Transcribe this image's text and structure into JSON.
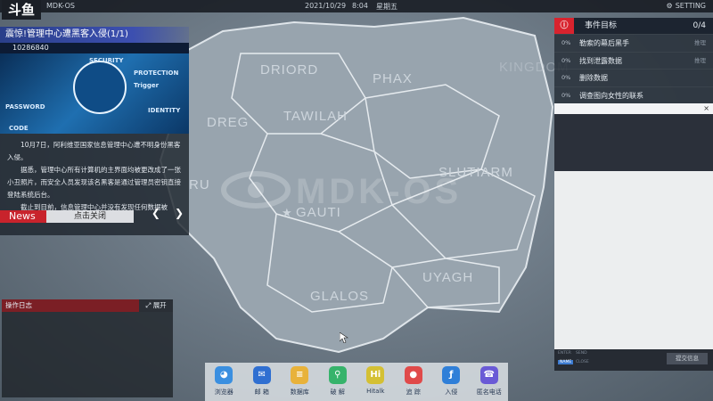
{
  "topbar": {
    "logo": "斗鱼",
    "os_name": "MDK-OS",
    "date": "2021/10/29",
    "time": "8:04",
    "weekday": "星期五",
    "setting": "SETTING"
  },
  "map": {
    "watermark": "MDK-OS",
    "regions": [
      "DRIORD",
      "PHAX",
      "DREG",
      "TAWILAH",
      "SLUTIARM",
      "GAUTI",
      "UYAGH",
      "GLALOS",
      "RU",
      "KINGDOM"
    ]
  },
  "news": {
    "title": "震惊!管理中心遭黑客入侵(1/1)",
    "id": "10286840",
    "banner_keywords": [
      "PASSWORD",
      "PROTECTION",
      "IDENTITY",
      "Trigger",
      "CODE",
      "SECURITY"
    ],
    "paragraphs": [
      "10月7日，阿利维亚国家信息管理中心遭不明身份黑客入侵。",
      "据悉，管理中心所有计算机的主界面均被更改成了一张小丑照片，而安全人员发现该名黑客是通过管理员密钥直接登陆系统后台。",
      "截止到目前，信息管理中心并没有发现任何数据被"
    ],
    "prev": "❮",
    "next": "❯",
    "tab_label": "News",
    "close_label": "点击关闭"
  },
  "log": {
    "title": "操作日志",
    "expand": "展开"
  },
  "objectives": {
    "title": "事件目标",
    "count": "0/4",
    "items": [
      {
        "pct": "0%",
        "text": "勒索的幕后黑手",
        "hint": "推理"
      },
      {
        "pct": "0%",
        "text": "找到泄露数据",
        "hint": "推理"
      },
      {
        "pct": "0%",
        "text": "删除数据",
        "hint": ""
      },
      {
        "pct": "0%",
        "text": "调查图向女性的联系",
        "hint": ""
      }
    ]
  },
  "chat": {
    "close": "×",
    "footer": [
      "ENTER",
      "NAME",
      "SEND",
      "CLOSE"
    ],
    "submit": "提交信息"
  },
  "dock": {
    "apps": [
      {
        "label": "浏览器",
        "icon": "browser-icon",
        "color": "#3a8fe0",
        "glyph": "◕"
      },
      {
        "label": "邮 箱",
        "icon": "mail-icon",
        "color": "#2f6fd1",
        "glyph": "✉"
      },
      {
        "label": "数据库",
        "icon": "database-icon",
        "color": "#e8b23a",
        "glyph": "≡"
      },
      {
        "label": "破 解",
        "icon": "crack-icon",
        "color": "#36b36b",
        "glyph": "⚲"
      },
      {
        "label": "Hitalk",
        "icon": "hitalk-icon",
        "color": "#d4c034",
        "glyph": "Hi"
      },
      {
        "label": "追 踪",
        "icon": "track-icon",
        "color": "#e04a4a",
        "glyph": "●"
      },
      {
        "label": "入侵",
        "icon": "hack-icon",
        "color": "#2f7fd8",
        "glyph": "ƒ"
      },
      {
        "label": "匿名电话",
        "icon": "phone-icon",
        "color": "#6a5ad6",
        "glyph": "☎"
      }
    ]
  }
}
